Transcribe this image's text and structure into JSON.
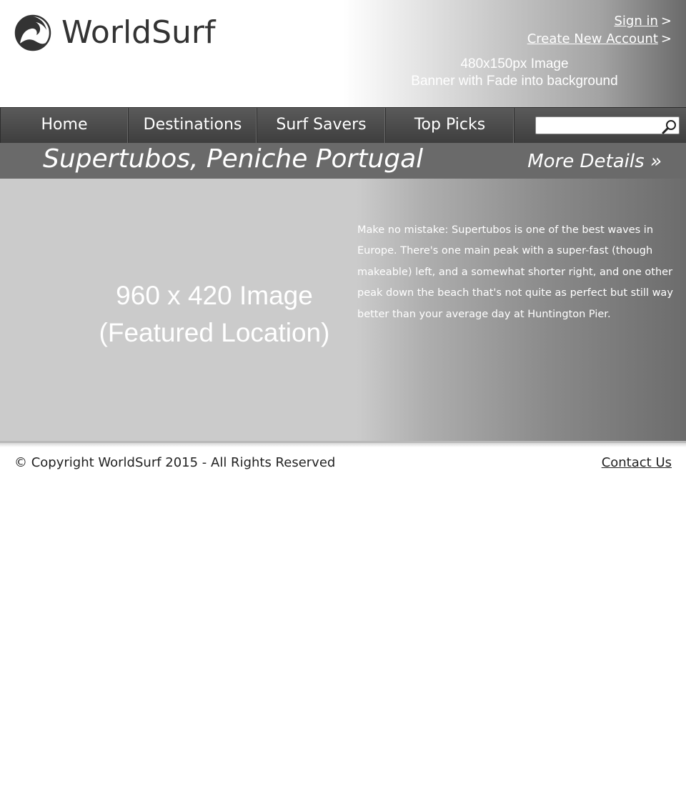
{
  "header": {
    "logo_text": "WorldSurf",
    "banner_line1": "480x150px Image",
    "banner_line2": "Banner with Fade into background",
    "sign_in": "Sign in",
    "create_account": "Create New Account",
    "link_arrow": ">"
  },
  "nav": {
    "items": [
      {
        "label": "Home"
      },
      {
        "label": "Destinations"
      },
      {
        "label": "Surf Savers"
      },
      {
        "label": "Top Picks"
      }
    ],
    "search_value": ""
  },
  "featured": {
    "title": "Supertubos, Peniche Portugal",
    "more_details": "More Details »",
    "image_line1": "960 x 420 Image",
    "image_line2": "(Featured Location)",
    "description": "Make no mistake: Supertubos is one of the best waves in Europe. There's one main peak with a super-fast (though makeable) left, and a somewhat shorter right, and one other peak down the beach that's not quite as perfect but still way better than your average day at Huntington Pier."
  },
  "footer": {
    "copyright": "© Copyright WorldSurf 2015 - All Rights Reserved",
    "contact": "Contact Us"
  },
  "colors": {
    "nav_bg": "#4a4a4a",
    "title_bar": "#6a6a6a",
    "featured_bg": "#cbcbcb",
    "text": "#333333"
  },
  "icons": [
    "worldsurf-logo-icon",
    "search-icon"
  ]
}
